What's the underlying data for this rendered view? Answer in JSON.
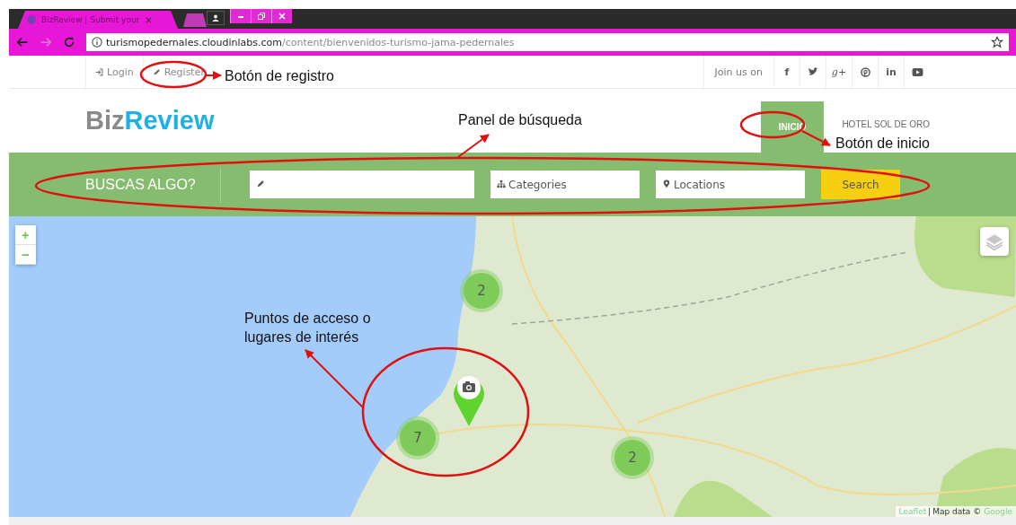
{
  "browser": {
    "tab_title": "BizReview | Submit your",
    "url_host": "turismopedernales.cloudinlabs.com",
    "url_path": "/content/bienvenidos-turismo-jama-pedernales"
  },
  "top_bar": {
    "links": [
      {
        "kind": "login",
        "label": "Login"
      },
      {
        "kind": "register",
        "label": "Register"
      }
    ],
    "join_label": "Join us on",
    "social": [
      {
        "kind": "facebook",
        "glyph": "f"
      },
      {
        "kind": "twitter"
      },
      {
        "kind": "google-plus",
        "glyph": "g+"
      },
      {
        "kind": "pinterest"
      },
      {
        "kind": "linkedin",
        "glyph": "in"
      },
      {
        "kind": "youtube"
      }
    ]
  },
  "header": {
    "logo_first": "Biz",
    "logo_second": "Review",
    "nav": [
      {
        "label": "INICIO",
        "selected": true
      },
      {
        "label": "HOTEL SOL DE ORO",
        "selected": false
      }
    ]
  },
  "search": {
    "title": "BUSCAS ALGO?",
    "fields": [
      {
        "kind": "keyword"
      },
      {
        "kind": "category",
        "placeholder": "Categories"
      },
      {
        "kind": "location",
        "placeholder": "Locations"
      }
    ],
    "button": "Search"
  },
  "map": {
    "zoom_in": "+",
    "zoom_out": "−",
    "clusters": [
      {
        "count": "2"
      },
      {
        "count": "7"
      },
      {
        "count": "2"
      }
    ],
    "attribution_link": "Leaflet",
    "attribution_text": "Map data ©",
    "attribution_brand": "Google"
  },
  "annotations": [
    {
      "text": "Botón de registro"
    },
    {
      "text": "Panel de búsqueda"
    },
    {
      "text": "Botón de inicio"
    },
    {
      "text": "Puntos de acceso o lugares de interés"
    }
  ]
}
